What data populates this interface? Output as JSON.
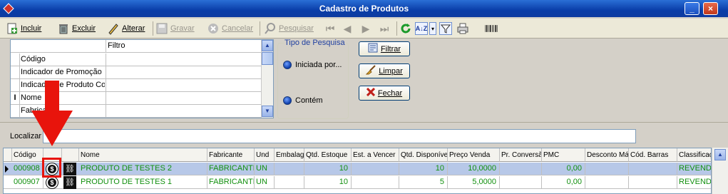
{
  "window": {
    "title": "Cadastro de Produtos"
  },
  "toolbar": {
    "incluir": "Incluir",
    "excluir": "Excluir",
    "alterar": "Alterar",
    "gravar": "Gravar",
    "cancelar": "Cancelar",
    "pesquisar": "Pesquisar"
  },
  "filter": {
    "header_col2": "Filtro",
    "rows": [
      {
        "label": "Código",
        "indicator": ""
      },
      {
        "label": "Indicador de Promoção",
        "indicator": ""
      },
      {
        "label": "Indicador de Produto Controlado",
        "indicator": ""
      },
      {
        "label": "Nome",
        "indicator": "I"
      },
      {
        "label": "Fabricante",
        "indicator": ""
      }
    ]
  },
  "search_type": {
    "legend": "Tipo de Pesquisa",
    "option1": "Iniciada por...",
    "option2": "Contém"
  },
  "actions": {
    "filtrar": "Filtrar",
    "limpar": "Limpar",
    "fechar": "Fechar"
  },
  "localizar": {
    "label": "Localizar",
    "value": ""
  },
  "table": {
    "headers": [
      "Código",
      "",
      "",
      "Nome",
      "Fabricante",
      "Und",
      "Embalagem",
      "Qtd. Estoque",
      "Est. a Vencer",
      "Qtd. Disponível",
      "Preço Venda",
      "Pr. Conversão",
      "PMC",
      "Desconto Máx.",
      "Cód. Barras",
      "Classificação"
    ],
    "rows": [
      {
        "codigo": "000908",
        "nome": "PRODUTO DE TESTES 2",
        "fabricante": "FABRICANTE",
        "und": "UN",
        "embalagem": "",
        "qtd_estoque": "10",
        "est_vencer": "",
        "qtd_disponivel": "10",
        "preco_venda": "10,0000",
        "pr_conversao": "",
        "pmc": "0,00",
        "desconto": "",
        "cod_barras": "",
        "classificacao": "REVENDA"
      },
      {
        "codigo": "000907",
        "nome": "PRODUTO DE TESTES 1",
        "fabricante": "FABRICANTE",
        "und": "UN",
        "embalagem": "",
        "qtd_estoque": "10",
        "est_vencer": "",
        "qtd_disponivel": "5",
        "preco_venda": "5,0000",
        "pr_conversao": "",
        "pmc": "0,00",
        "desconto": "",
        "cod_barras": "",
        "classificacao": "REVENDA"
      }
    ]
  },
  "colors": {
    "titlebar": "#0a3da8",
    "selected_row": "#b7c8e8",
    "data_text": "#12900f",
    "annotation": "#e8140c"
  }
}
